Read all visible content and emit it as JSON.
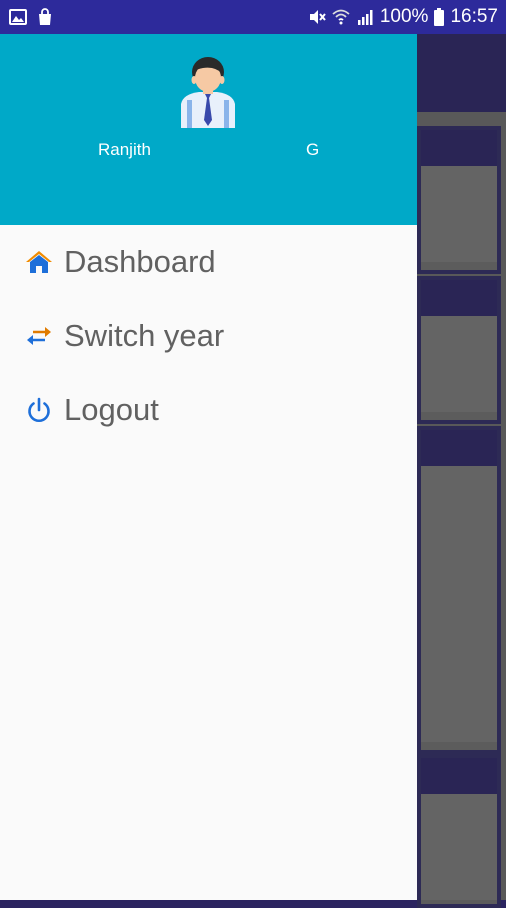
{
  "status_bar": {
    "battery": "100%",
    "time": "16:57",
    "icons": [
      "gallery-icon",
      "shopping-bag-icon",
      "mute-icon",
      "wifi-icon",
      "signal-icon",
      "battery-icon"
    ]
  },
  "drawer": {
    "header": {
      "first_name": "Ranjith",
      "last_name": "G",
      "background_color": "#00a9c8"
    },
    "items": [
      {
        "label": "Dashboard",
        "icon": "home-icon",
        "icon_color": "#1e6fd9"
      },
      {
        "label": "Switch year",
        "icon": "swap-arrows-icon",
        "icon_color": "#e07b00"
      },
      {
        "label": "Logout",
        "icon": "power-icon",
        "icon_color": "#1e6fd9"
      }
    ]
  },
  "colors": {
    "status_bar": "#2d2a9b",
    "app_toolbar": "#2a2555",
    "drawer_bg": "#fafafa",
    "menu_text": "#616161"
  }
}
